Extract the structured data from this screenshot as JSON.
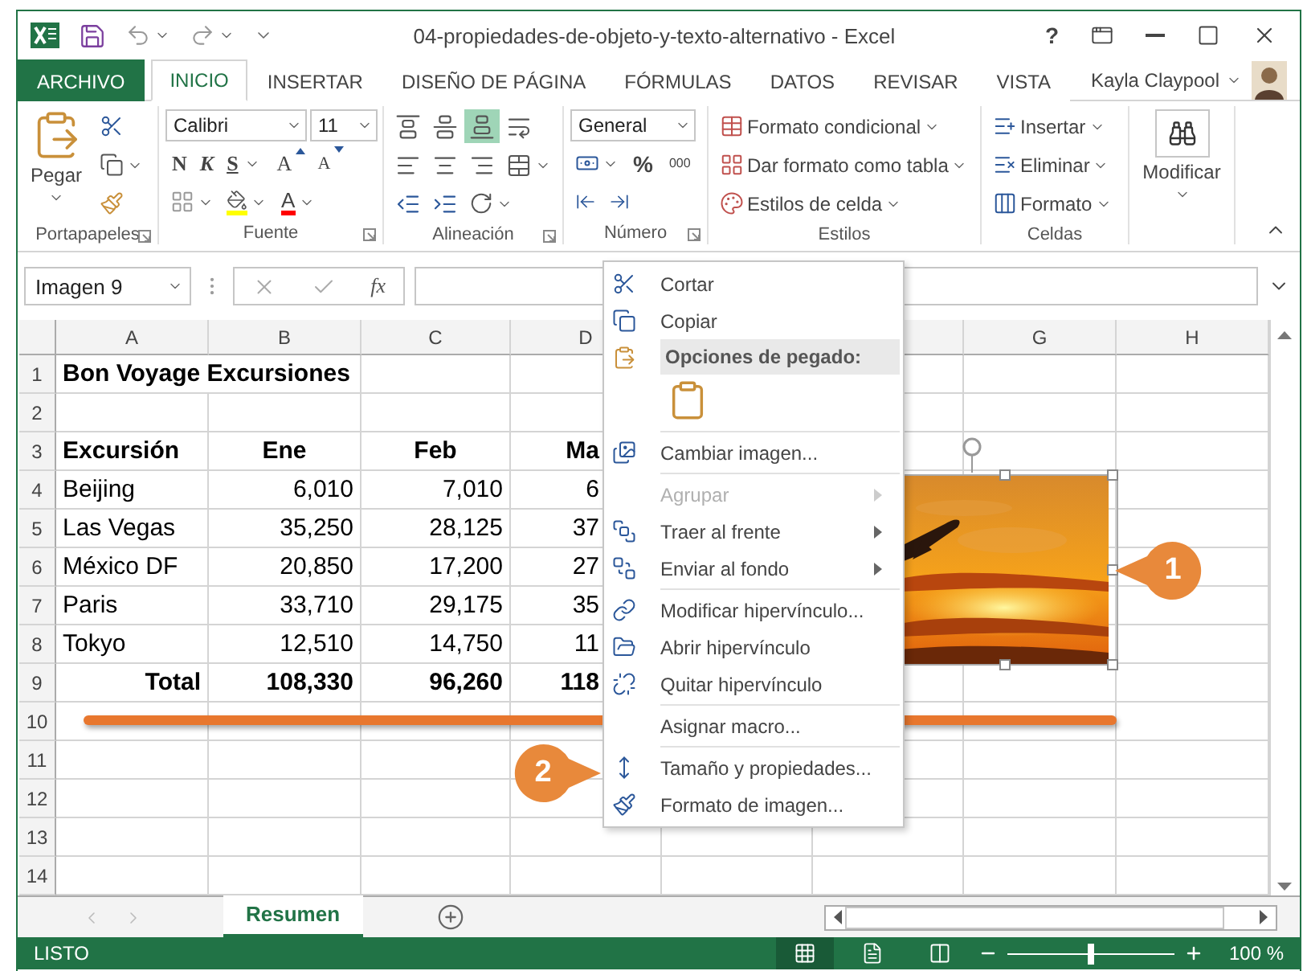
{
  "window": {
    "title": "04-propiedades-de-objeto-y-texto-alternativo - Excel",
    "help": "?"
  },
  "tabs": [
    {
      "label": "ARCHIVO",
      "kind": "file",
      "selected": false
    },
    {
      "label": "INICIO",
      "kind": "tab",
      "selected": true
    },
    {
      "label": "INSERTAR",
      "kind": "tab",
      "selected": false
    },
    {
      "label": "DISEÑO DE PÁGINA",
      "kind": "tab",
      "selected": false
    },
    {
      "label": "FÓRMULAS",
      "kind": "tab",
      "selected": false
    },
    {
      "label": "DATOS",
      "kind": "tab",
      "selected": false
    },
    {
      "label": "REVISAR",
      "kind": "tab",
      "selected": false
    },
    {
      "label": "VISTA",
      "kind": "tab",
      "selected": false
    }
  ],
  "user": {
    "name": "Kayla Claypool"
  },
  "ribbon": {
    "clipboard": {
      "label": "Portapapeles",
      "paste": "Pegar"
    },
    "font": {
      "label": "Fuente",
      "name": "Calibri",
      "size": "11",
      "bold": "N",
      "italic": "K",
      "underline": "S",
      "grow": "A",
      "shrink": "A",
      "font_color_button": "A"
    },
    "alignment": {
      "label": "Alineación",
      "vertical": [
        {
          "selected": false
        },
        {
          "selected": false
        },
        {
          "selected": true
        }
      ]
    },
    "number": {
      "label": "Número",
      "format": "General",
      "percent": "%",
      "thousands": "000"
    },
    "styles": {
      "label": "Estilos",
      "items": [
        "Formato condicional",
        "Dar formato como tabla",
        "Estilos de celda"
      ]
    },
    "cells": {
      "label": "Celdas",
      "items": [
        "Insertar",
        "Eliminar",
        "Formato"
      ]
    },
    "editing": {
      "label": "Modificar"
    }
  },
  "formula_bar": {
    "name_box": "Imagen 9",
    "fx": "fx"
  },
  "sheet": {
    "columns": [
      "A",
      "B",
      "C",
      "D",
      null,
      null,
      "G",
      "H"
    ],
    "rows": [
      {
        "number": "1",
        "kind": "title",
        "cells": [
          "Bon Voyage Excursiones"
        ]
      },
      {
        "number": "2",
        "kind": "blank"
      },
      {
        "number": "3",
        "kind": "header",
        "cells": [
          "Excursión",
          "Ene",
          "Feb",
          "Ma"
        ]
      },
      {
        "number": "4",
        "kind": "data",
        "cells": [
          "Beijing",
          "6,010",
          "7,010",
          "6"
        ]
      },
      {
        "number": "5",
        "kind": "data",
        "cells": [
          "Las Vegas",
          "35,250",
          "28,125",
          "37"
        ]
      },
      {
        "number": "6",
        "kind": "data",
        "cells": [
          "México DF",
          "20,850",
          "17,200",
          "27"
        ]
      },
      {
        "number": "7",
        "kind": "data",
        "cells": [
          "Paris",
          "33,710",
          "29,175",
          "35"
        ]
      },
      {
        "number": "8",
        "kind": "data",
        "cells": [
          "Tokyo",
          "12,510",
          "14,750",
          "11"
        ]
      },
      {
        "number": "9",
        "kind": "total",
        "cells": [
          "Total",
          "108,330",
          "96,260",
          "118"
        ]
      },
      {
        "number": "10",
        "kind": "marked"
      },
      {
        "number": "11",
        "kind": "blank"
      },
      {
        "number": "12",
        "kind": "blank"
      },
      {
        "number": "13",
        "kind": "blank"
      },
      {
        "number": "14",
        "kind": "blank"
      }
    ]
  },
  "picture": {
    "selected": true
  },
  "context_menu": {
    "items": [
      {
        "kind": "item",
        "label": "Cortar",
        "disabled": false,
        "submenu": false
      },
      {
        "kind": "item",
        "label": "Copiar",
        "disabled": false,
        "submenu": false
      },
      {
        "kind": "header",
        "label": "Opciones de pegado:"
      },
      {
        "kind": "paste"
      },
      {
        "kind": "separator"
      },
      {
        "kind": "item",
        "label": "Cambiar imagen...",
        "disabled": false,
        "submenu": false
      },
      {
        "kind": "separator"
      },
      {
        "kind": "item",
        "label": "Agrupar",
        "disabled": true,
        "submenu": true
      },
      {
        "kind": "item",
        "label": "Traer al frente",
        "disabled": false,
        "submenu": true
      },
      {
        "kind": "item",
        "label": "Enviar al fondo",
        "disabled": false,
        "submenu": true
      },
      {
        "kind": "separator"
      },
      {
        "kind": "item",
        "label": "Modificar hipervínculo...",
        "disabled": false,
        "submenu": false
      },
      {
        "kind": "item",
        "label": "Abrir hipervínculo",
        "disabled": false,
        "submenu": false
      },
      {
        "kind": "item",
        "label": "Quitar hipervínculo",
        "disabled": false,
        "submenu": false
      },
      {
        "kind": "separator"
      },
      {
        "kind": "item",
        "label": "Asignar macro...",
        "disabled": false,
        "submenu": false
      },
      {
        "kind": "separator"
      },
      {
        "kind": "item",
        "label": "Tamaño y propiedades...",
        "disabled": false,
        "submenu": false
      },
      {
        "kind": "item",
        "label": "Formato de imagen...",
        "disabled": false,
        "submenu": false
      }
    ]
  },
  "callouts": [
    "1",
    "2"
  ],
  "sheet_tabs": [
    {
      "label": "Resumen",
      "selected": true
    }
  ],
  "status_bar": {
    "status": "LISTO",
    "view_modes": [
      {
        "selected": true
      },
      {
        "selected": false
      },
      {
        "selected": false
      }
    ],
    "zoom_slider": {
      "level": 0.5
    },
    "zoom": "100 %"
  }
}
